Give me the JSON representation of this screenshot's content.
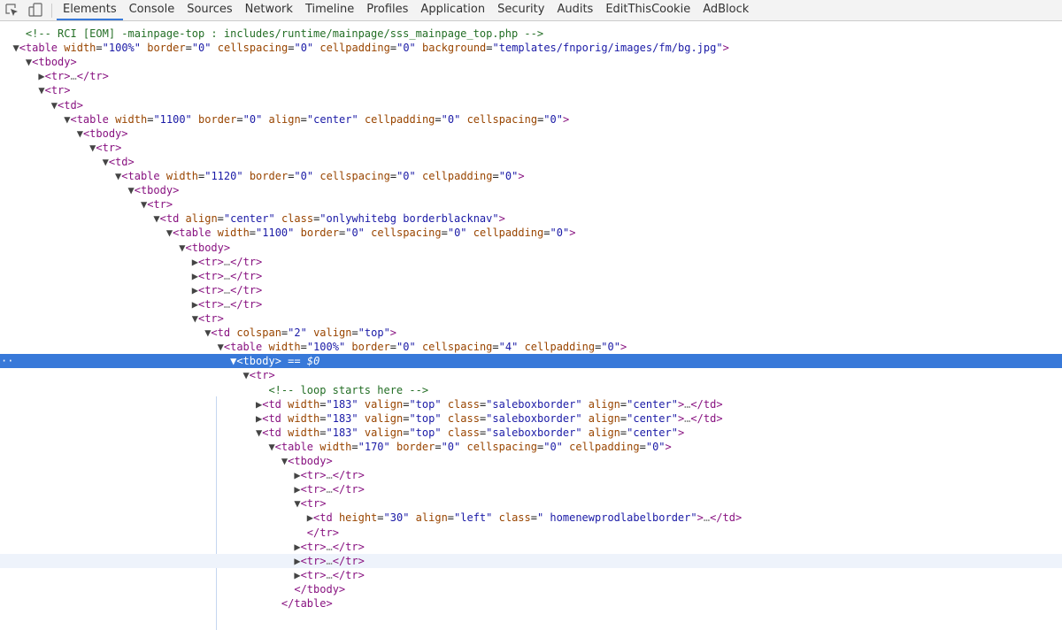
{
  "toolbar": {
    "tabs": [
      "Elements",
      "Console",
      "Sources",
      "Network",
      "Timeline",
      "Profiles",
      "Application",
      "Security",
      "Audits",
      "EditThisCookie",
      "AdBlock"
    ],
    "active_tab": "Elements",
    "icons": [
      "select-element-icon",
      "device-toolbar-icon"
    ]
  },
  "dom_tree": [
    {
      "t": "    <!-- RCI [EOM] -mainpage-top : includes/runtime/mainpage/sss_mainpage_top.php -->"
    },
    {
      "t": "  ▼<table width=\"100%\" border=\"0\" cellspacing=\"0\" cellpadding=\"0\" background=\"templates/fnporig/images/fm/bg.jpg\">"
    },
    {
      "t": "    ▼<tbody>"
    },
    {
      "t": "      ▶<tr>…</tr>"
    },
    {
      "t": "      ▼<tr>"
    },
    {
      "t": "        ▼<td>"
    },
    {
      "t": "          ▼<table width=\"1100\" border=\"0\" align=\"center\" cellpadding=\"0\" cellspacing=\"0\">"
    },
    {
      "t": "            ▼<tbody>"
    },
    {
      "t": "              ▼<tr>"
    },
    {
      "t": "                ▼<td>"
    },
    {
      "t": "                  ▼<table width=\"1120\" border=\"0\" cellspacing=\"0\" cellpadding=\"0\">"
    },
    {
      "t": "                    ▼<tbody>"
    },
    {
      "t": "                      ▼<tr>"
    },
    {
      "t": "                        ▼<td align=\"center\" class=\"onlywhitebg borderblacknav\">"
    },
    {
      "t": "                          ▼<table width=\"1100\" border=\"0\" cellspacing=\"0\" cellpadding=\"0\">"
    },
    {
      "t": "                            ▼<tbody>"
    },
    {
      "t": "                              ▶<tr>…</tr>"
    },
    {
      "t": "                              ▶<tr>…</tr>"
    },
    {
      "t": "                              ▶<tr>…</tr>"
    },
    {
      "t": "                              ▶<tr>…</tr>"
    },
    {
      "t": "                              ▼<tr>"
    },
    {
      "t": "                                ▼<td colspan=\"2\" valign=\"top\">"
    },
    {
      "t": "                                  ▼<table width=\"100%\" border=\"0\" cellspacing=\"4\" cellpadding=\"0\">"
    },
    {
      "t": "                                    ▼<tbody> == $0",
      "state": "selected"
    },
    {
      "t": "                                      ▼<tr>"
    },
    {
      "t": "                                          <!-- loop starts here -->"
    },
    {
      "t": "                                        ▶<td width=\"183\" valign=\"top\" class=\"saleboxborder\" align=\"center\">…</td>"
    },
    {
      "t": "                                        ▶<td width=\"183\" valign=\"top\" class=\"saleboxborder\" align=\"center\">…</td>"
    },
    {
      "t": "                                        ▼<td width=\"183\" valign=\"top\" class=\"saleboxborder\" align=\"center\">"
    },
    {
      "t": "                                          ▼<table width=\"170\" border=\"0\" cellspacing=\"0\" cellpadding=\"0\">"
    },
    {
      "t": "                                            ▼<tbody>"
    },
    {
      "t": "                                              ▶<tr>…</tr>"
    },
    {
      "t": "                                              ▶<tr>…</tr>"
    },
    {
      "t": "                                              ▼<tr>"
    },
    {
      "t": "                                                ▶<td height=\"30\" align=\"left\" class=\" homenewprodlabelborder\">…</td>"
    },
    {
      "t": "                                                </tr>"
    },
    {
      "t": "                                              ▶<tr>…</tr>"
    },
    {
      "t": "                                              ▶<tr>…</tr>",
      "state": "hover"
    },
    {
      "t": "                                              ▶<tr>…</tr>"
    },
    {
      "t": "                                              </tbody>"
    },
    {
      "t": "                                            </table>"
    }
  ],
  "colors": {
    "selected_bg": "#3879d9",
    "hover_bg": "#eef3fb",
    "tag": "#881280",
    "attr_name": "#994500",
    "attr_value": "#1a1aa6",
    "comment": "#236e25"
  }
}
